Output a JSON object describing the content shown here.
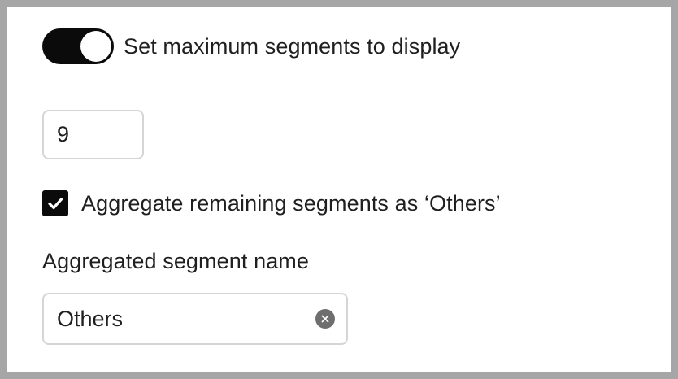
{
  "max_segments_toggle": {
    "label": "Set maximum segments to display",
    "on": true
  },
  "max_segments_input": {
    "value": "9"
  },
  "aggregate_checkbox": {
    "label": "Aggregate remaining segments as ‘Others’",
    "checked": true
  },
  "aggregated_name": {
    "label": "Aggregated segment name",
    "value": "Others",
    "clear_icon": "clear-icon"
  },
  "colors": {
    "toggle_on": "#0b0b0b",
    "checkbox": "#0b0b0b",
    "border": "#d5d5d5",
    "frame": "#a6a6a6"
  }
}
